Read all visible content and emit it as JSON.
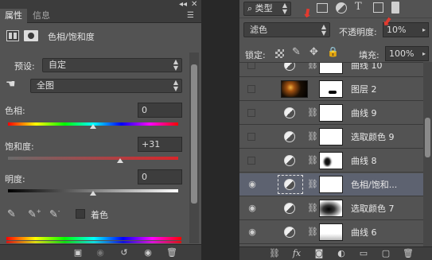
{
  "properties_panel": {
    "tabs": [
      {
        "label": "属性"
      },
      {
        "label": "信息"
      }
    ],
    "collapse_glyph": "◂◂",
    "menu_glyph": "☰",
    "header_title": "色相/饱和度",
    "preset_label": "预设:",
    "preset_value": "自定",
    "channel_value": "全图",
    "hue_label": "色相:",
    "hue_value": "0",
    "saturation_label": "饱和度:",
    "saturation_value": "+31",
    "lightness_label": "明度:",
    "lightness_value": "0",
    "colorize_label": "着色",
    "colorize_checked": false,
    "hue_level": 0.5,
    "saturation_level": 0.66,
    "lightness_level": 0.5
  },
  "layers_panel": {
    "filter_label": "类型",
    "blend_mode": "滤色",
    "opacity_label": "不透明度:",
    "opacity_value": "10%",
    "lock_label": "锁定:",
    "fill_label": "填充:",
    "fill_value": "100%",
    "layers": [
      {
        "name": "曲线 10",
        "visible": false,
        "kind": "adjustment"
      },
      {
        "name": "图层 2",
        "visible": false,
        "kind": "pixel"
      },
      {
        "name": "曲线 9",
        "visible": false,
        "kind": "adjustment"
      },
      {
        "name": "选取颜色 9",
        "visible": false,
        "kind": "adjustment"
      },
      {
        "name": "曲线 8",
        "visible": false,
        "kind": "adjustment"
      },
      {
        "name": "色相/饱和...",
        "visible": true,
        "kind": "adjustment",
        "selected": true
      },
      {
        "name": "选取颜色 7",
        "visible": true,
        "kind": "adjustment"
      },
      {
        "name": "曲线 6",
        "visible": true,
        "kind": "adjustment"
      }
    ]
  },
  "colors": {
    "panel_bg": "#535353",
    "selected_row": "#5d6270",
    "annotation_red": "#e23a2f"
  }
}
